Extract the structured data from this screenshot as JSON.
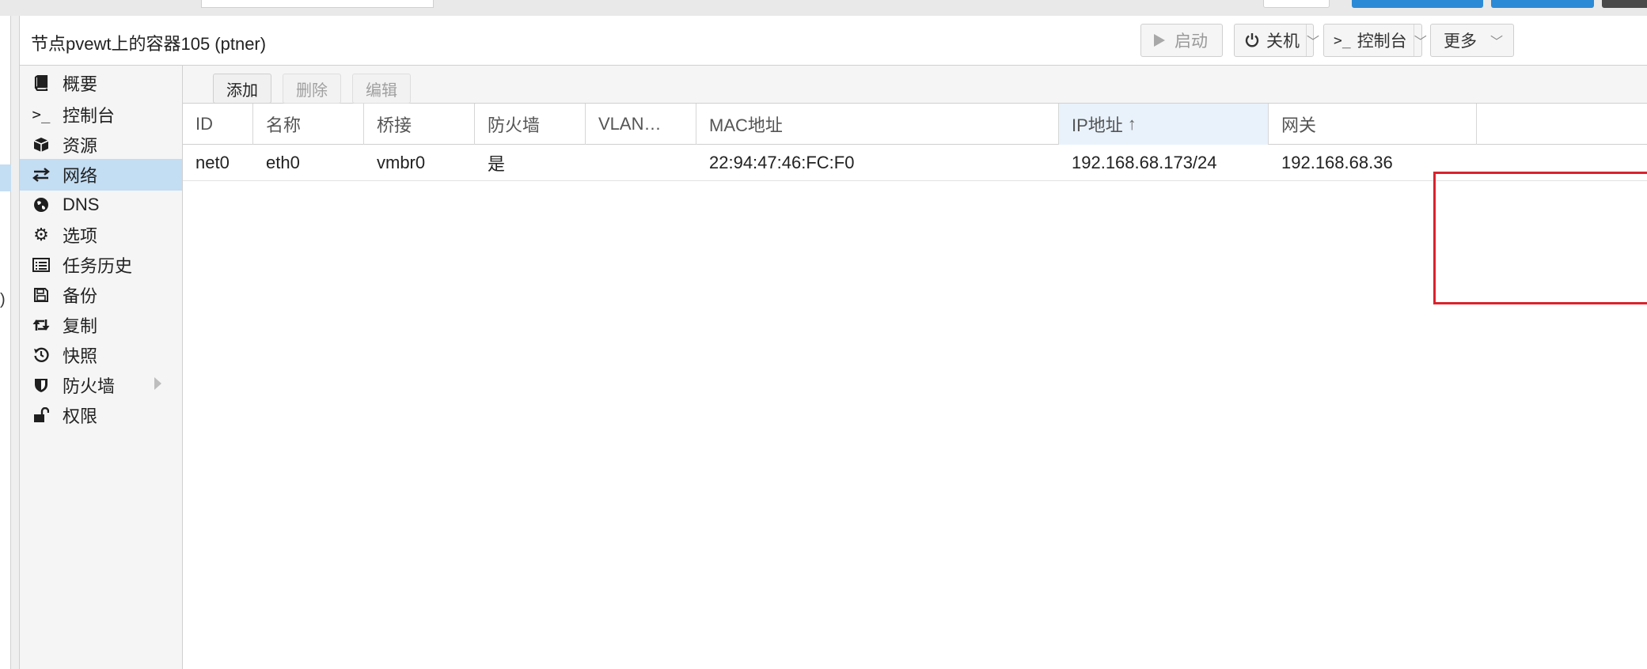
{
  "left_tree_fragment": ")",
  "header": {
    "title": "节点pvewt上的容器105 (ptner)",
    "buttons": {
      "start_label": "启动",
      "shutdown_label": "关机",
      "console_label": "控制台",
      "more_label": "更多"
    }
  },
  "sidebar": {
    "items": [
      {
        "label": "概要",
        "icon": "book-icon"
      },
      {
        "label": "控制台",
        "icon": "terminal-icon"
      },
      {
        "label": "资源",
        "icon": "cube-icon"
      },
      {
        "label": "网络",
        "icon": "exchange-icon",
        "selected": true
      },
      {
        "label": "DNS",
        "icon": "globe-icon"
      },
      {
        "label": "选项",
        "icon": "gear-icon"
      },
      {
        "label": "任务历史",
        "icon": "list-alt-icon"
      },
      {
        "label": "备份",
        "icon": "floppy-icon"
      },
      {
        "label": "复制",
        "icon": "retweet-icon"
      },
      {
        "label": "快照",
        "icon": "history-icon"
      },
      {
        "label": "防火墙",
        "icon": "shield-icon",
        "has_submenu": true
      },
      {
        "label": "权限",
        "icon": "unlock-icon"
      }
    ]
  },
  "toolbar": {
    "add_label": "添加",
    "remove_label": "删除",
    "edit_label": "编辑"
  },
  "grid": {
    "columns": [
      "ID",
      "名称",
      "桥接",
      "防火墙",
      "VLAN…",
      "MAC地址",
      "IP地址",
      "网关"
    ],
    "sorted_column": "IP地址",
    "rows": [
      {
        "id": "net0",
        "name": "eth0",
        "bridge": "vmbr0",
        "firewall": "是",
        "vlan": "",
        "mac": "22:94:47:46:FC:F0",
        "ip": "192.168.68.173/24",
        "gateway": "192.168.68.36"
      }
    ]
  },
  "colors": {
    "selected_bg": "#c3ddf3",
    "highlight_border": "#d9232d",
    "accent_blue": "#2b8ad6"
  }
}
